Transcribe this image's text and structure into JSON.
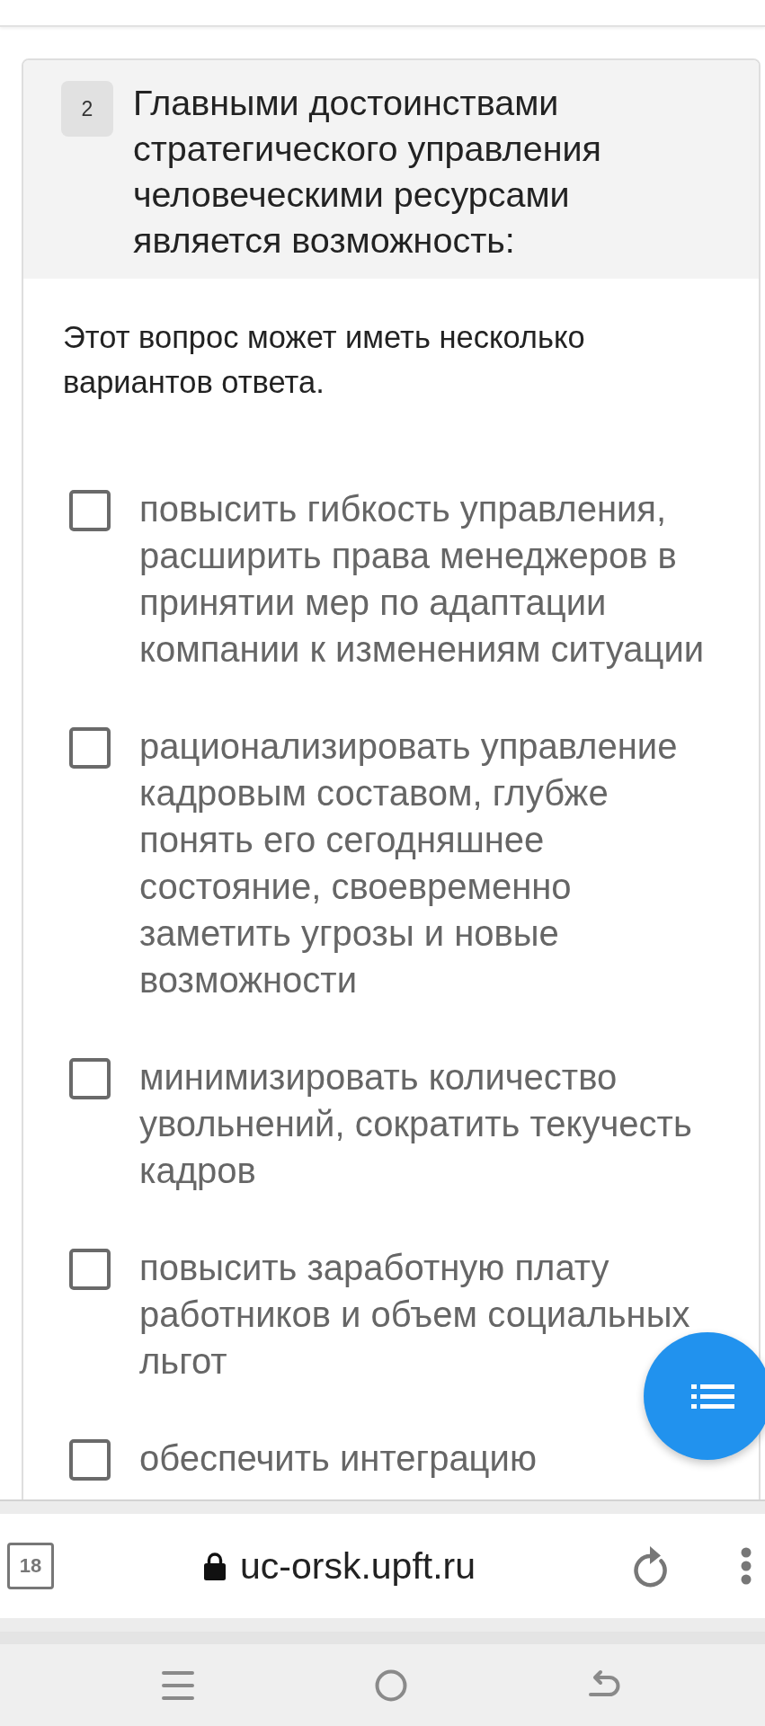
{
  "question": {
    "number": "2",
    "text": "Главными достоинствами стратегического управления человеческими ресурсами является возможность:",
    "hint": "Этот вопрос может иметь несколько вариантов ответа.",
    "options": [
      {
        "text": "повысить гибкость управления, расширить права менеджеров в принятии мер по адаптации компании к изменениям ситуации",
        "checked": false
      },
      {
        "text": "рационализировать управление кадровым составом, глубже понять его сегодняшнее состояние, своевременно заметить угрозы и новые возможности",
        "checked": false
      },
      {
        "text": "минимизировать количество увольнений, сократить текучесть кадров",
        "checked": false
      },
      {
        "text": "повысить заработную плату работников и объем социальных льгот",
        "checked": false
      },
      {
        "text": "обеспечить интеграцию",
        "checked": false
      }
    ]
  },
  "browser": {
    "tab_count": "18",
    "url": "uc-orsk.upft.ru"
  }
}
